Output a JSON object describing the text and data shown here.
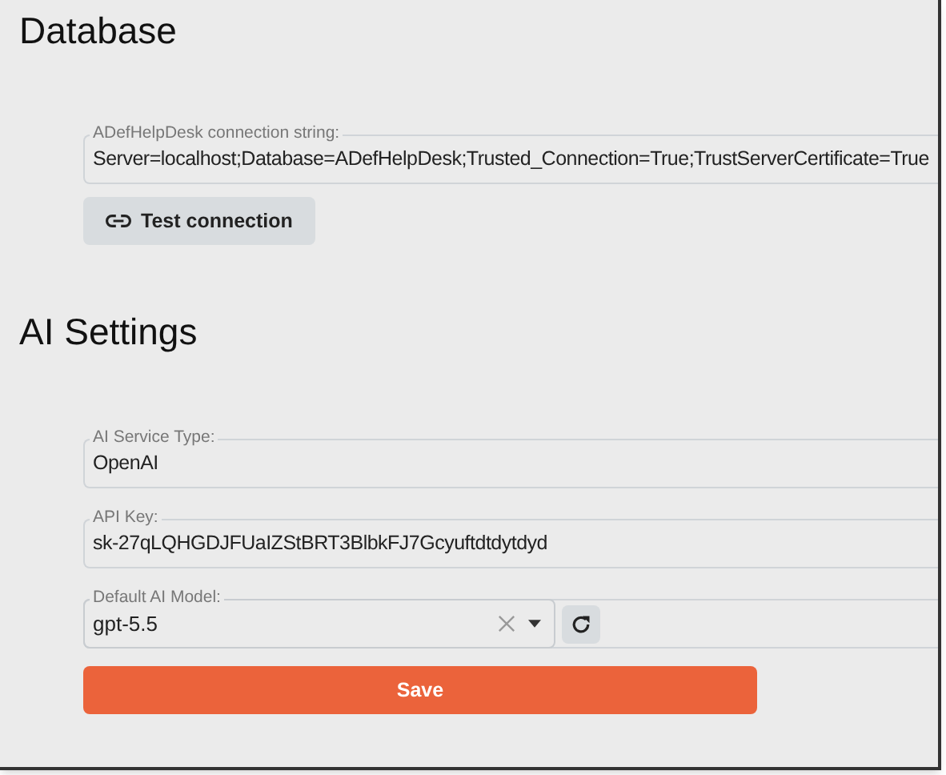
{
  "sections": [
    {
      "title": "Database",
      "fields": [
        {
          "kind": "text",
          "label": "ADefHelpDesk connection string:",
          "value": "Server=localhost;Database=ADefHelpDesk;Trusted_Connection=True;TrustServerCertificate=True"
        }
      ],
      "button": {
        "label": "Test connection"
      }
    },
    {
      "title": "AI Settings",
      "fields": [
        {
          "kind": "text",
          "label": "AI Service Type:",
          "value": "OpenAI"
        },
        {
          "kind": "text",
          "label": "API Key:",
          "value": "sk-27qLQHGDJFUaIZStBRT3BlbkFJ7Gcyuftdtdytdyd"
        },
        {
          "kind": "select",
          "label": "Default AI Model:",
          "value": "gpt-5.5"
        }
      ]
    }
  ],
  "save_button": {
    "label": "Save"
  }
}
